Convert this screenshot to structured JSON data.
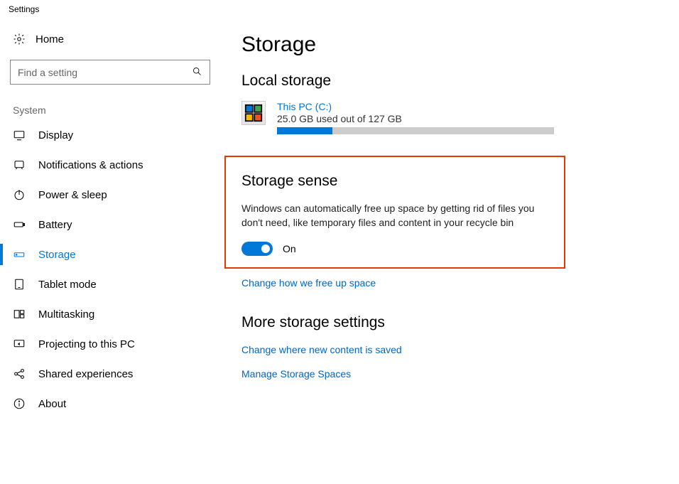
{
  "window_title": "Settings",
  "home_label": "Home",
  "search": {
    "placeholder": "Find a setting"
  },
  "section_label": "System",
  "nav": {
    "display": "Display",
    "notifications": "Notifications & actions",
    "power": "Power & sleep",
    "battery": "Battery",
    "storage": "Storage",
    "tablet": "Tablet mode",
    "multitasking": "Multitasking",
    "projecting": "Projecting to this PC",
    "shared": "Shared experiences",
    "about": "About"
  },
  "page_title": "Storage",
  "local_storage_title": "Local storage",
  "drive": {
    "name": "This PC (C:)",
    "usage_text": "25.0 GB used out of 127 GB",
    "percent": 20
  },
  "storage_sense": {
    "title": "Storage sense",
    "description": "Windows can automatically free up space by getting rid of files you don't need, like temporary files and content in your recycle bin",
    "toggle_label": "On",
    "link": "Change how we free up space"
  },
  "more": {
    "title": "More storage settings",
    "link1": "Change where new content is saved",
    "link2": "Manage Storage Spaces"
  }
}
